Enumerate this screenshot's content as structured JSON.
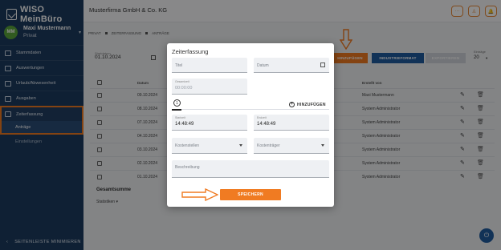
{
  "app": {
    "logo": "WISO MeinBüro"
  },
  "user": {
    "initials": "MM",
    "name": "Maxi Mustermann",
    "plan": "Privat"
  },
  "sidebar": {
    "items": [
      {
        "label": "Stammdaten",
        "icon": "address-card-icon"
      },
      {
        "label": "Auswertungen",
        "icon": "chart-icon"
      },
      {
        "label": "Urlaub/Abwesenheit",
        "icon": "calendar-icon"
      },
      {
        "label": "Ausgaben",
        "icon": "receipt-icon"
      }
    ],
    "active_group": {
      "label": "Zeiterfassung",
      "icon": "clock-people-icon"
    },
    "active_sub": "Anträge",
    "sub2": "Einstellungen",
    "minimize": "SEITENLEISTE MINIMIEREN"
  },
  "header": {
    "company": "Musterfirma GmbH & Co. KG",
    "btn1": "···",
    "btn2": "♙",
    "btn3": "🔔"
  },
  "breadcrumb": [
    "PRIVAT",
    "ZEITERFASSUNG",
    "ANTRÄGE"
  ],
  "filters": {
    "start_label": "Startdatum",
    "start_value": "01.10.2024",
    "add_button": "HINZUFÜGEN",
    "format_button": "INDUSTRIEFORMAT",
    "export_button": "EXPORTIEREN",
    "per_page_label": "Einträge",
    "per_page_value": "20"
  },
  "table": {
    "col_date": "Datum",
    "col_created": "Erstellt von",
    "rows": [
      {
        "date": "09.10.2024",
        "user": "Maxi Mustermann"
      },
      {
        "date": "08.10.2024",
        "user": "System Administrator"
      },
      {
        "date": "07.10.2024",
        "user": "System Administrator"
      },
      {
        "date": "04.10.2024",
        "user": "System Administrator"
      },
      {
        "date": "03.10.2024",
        "user": "System Administrator"
      },
      {
        "date": "02.10.2024",
        "user": "System Administrator"
      },
      {
        "date": "01.10.2024",
        "user": "System Administrator"
      }
    ],
    "total_label": "Gesamtsumme",
    "stats_label": "Statistiken"
  },
  "modal": {
    "title": "Zeiterfassung",
    "title_field": "Titel",
    "date_field": "Datum",
    "duration_label": "Gesamtzeit",
    "duration_value": "00:00:00",
    "step": "1",
    "add_link": "HINZUFÜGEN",
    "start_label": "Startzeit",
    "start_value": "14:48:49",
    "end_label": "Endzeit",
    "end_value": "14:48:49",
    "cost_center": "Kostenstellen",
    "cost_unit": "Kostenträger",
    "description": "Beschreibung",
    "save_button": "SPEICHERN"
  },
  "colors": {
    "accent": "#f07b22",
    "primary": "#1f5b9f",
    "sidebar": "#1d3b5f"
  }
}
